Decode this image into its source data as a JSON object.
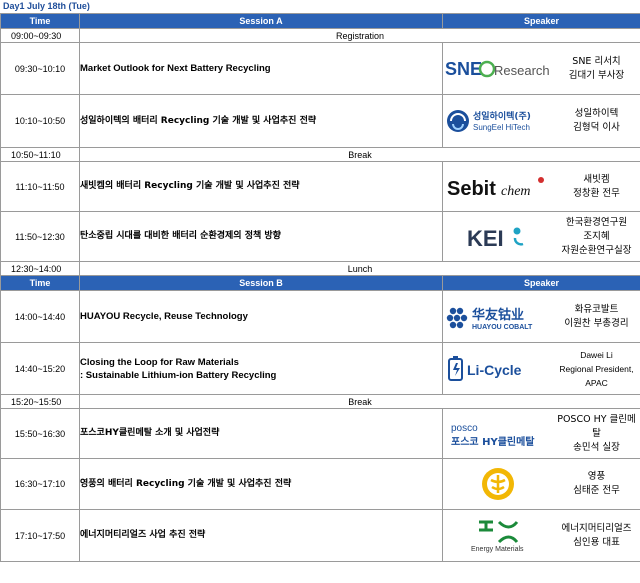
{
  "day_title": "Day1 July 18th (Tue)",
  "session_a_header": {
    "time": "Time",
    "session": "Session A",
    "speaker": "Speaker"
  },
  "session_b_header": {
    "time": "Time",
    "session": "Session B",
    "speaker": "Speaker"
  },
  "breaks": {
    "registration": {
      "time": "09:00~09:30",
      "label": "Registration"
    },
    "break1": {
      "time": "10:50~11:10",
      "label": "Break"
    },
    "lunch": {
      "time": "12:30~14:00",
      "label": "Lunch"
    },
    "break2": {
      "time": "15:20~15:50",
      "label": "Break"
    }
  },
  "session_a": [
    {
      "time": "09:30~10:10",
      "title": "Market Outlook for Next Battery Recycling",
      "logo": "SNE Research",
      "logo_text": "SNE",
      "logo_text2": "Research",
      "speaker_org": "SNE 리서치",
      "speaker_name": "김대기 부사장",
      "speaker_extra": ""
    },
    {
      "time": "10:10~10:50",
      "title": "성일하이텍의 배터리 Recycling 기술 개발 및 사업추진 전략",
      "logo": "SungEel HiTech",
      "logo_text": "성일하이텍(주)",
      "logo_text2": "SungEel HiTech",
      "speaker_org": "성일하이텍",
      "speaker_name": "김형덕 이사",
      "speaker_extra": ""
    },
    {
      "time": "11:10~11:50",
      "title": "새빗켐의 배터리 Recycling 기술 개발 및 사업추진 전략",
      "logo": "Sebitchem",
      "logo_text": "Sebit",
      "logo_text2": "chem",
      "speaker_org": "새빗켐",
      "speaker_name": "정창환 전무",
      "speaker_extra": ""
    },
    {
      "time": "11:50~12:30",
      "title": "탄소중립 시대를 대비한 배터리 순환경제의 정책 방향",
      "logo": "KEI",
      "logo_text": "KEI",
      "logo_text2": "",
      "speaker_org": "한국환경연구원",
      "speaker_name": "조지혜",
      "speaker_extra": "자원순환연구실장"
    }
  ],
  "session_b": [
    {
      "time": "14:00~14:40",
      "title": "HUAYOU Recycle, Reuse Technology",
      "title2": "",
      "logo": "HUAYOU COBALT",
      "logo_text": "华友钴业",
      "logo_text2": "HUAYOU COBALT",
      "speaker_org": "화유코발트",
      "speaker_name": "이원찬 부총경리"
    },
    {
      "time": "14:40~15:20",
      "title": "Closing the Loop for Raw Materials",
      "title2": ": Sustainable Lithium-ion Battery Recycling",
      "logo": "Li-Cycle",
      "logo_text": "Li-Cycle",
      "logo_text2": "",
      "speaker_org": "Dawei Li",
      "speaker_name": "Regional President, APAC"
    },
    {
      "time": "15:50~16:30",
      "title": "포스코HY클린메탈 소개 및 사업전략",
      "title2": "",
      "logo": "POSCO HY Clean Metal",
      "logo_text": "posco",
      "logo_text2": "포스코 HY클린메탈",
      "speaker_org": "POSCO HY 클린메탈",
      "speaker_name": "송민석 실장"
    },
    {
      "time": "16:30~17:10",
      "title": "영풍의 배터리 Recycling 기술 개발 및 사업추진 전략",
      "title2": "",
      "logo": "Young Poong",
      "logo_text": "",
      "logo_text2": "",
      "speaker_org": "영풍",
      "speaker_name": "심태준 전무"
    },
    {
      "time": "17:10~17:50",
      "title": "에너지머티리얼즈 사업 추진 전략",
      "title2": "",
      "logo": "Energy Materials",
      "logo_text": "Energy Materials",
      "logo_text2": "",
      "speaker_org": "에너지머티리얼즈",
      "speaker_name": "심인용 대표"
    }
  ],
  "colors": {
    "header_bg": "#2b62b5",
    "day_title": "#1f4e9a",
    "sne_blue": "#1b4f9c",
    "sne_green": "#4caf50"
  }
}
